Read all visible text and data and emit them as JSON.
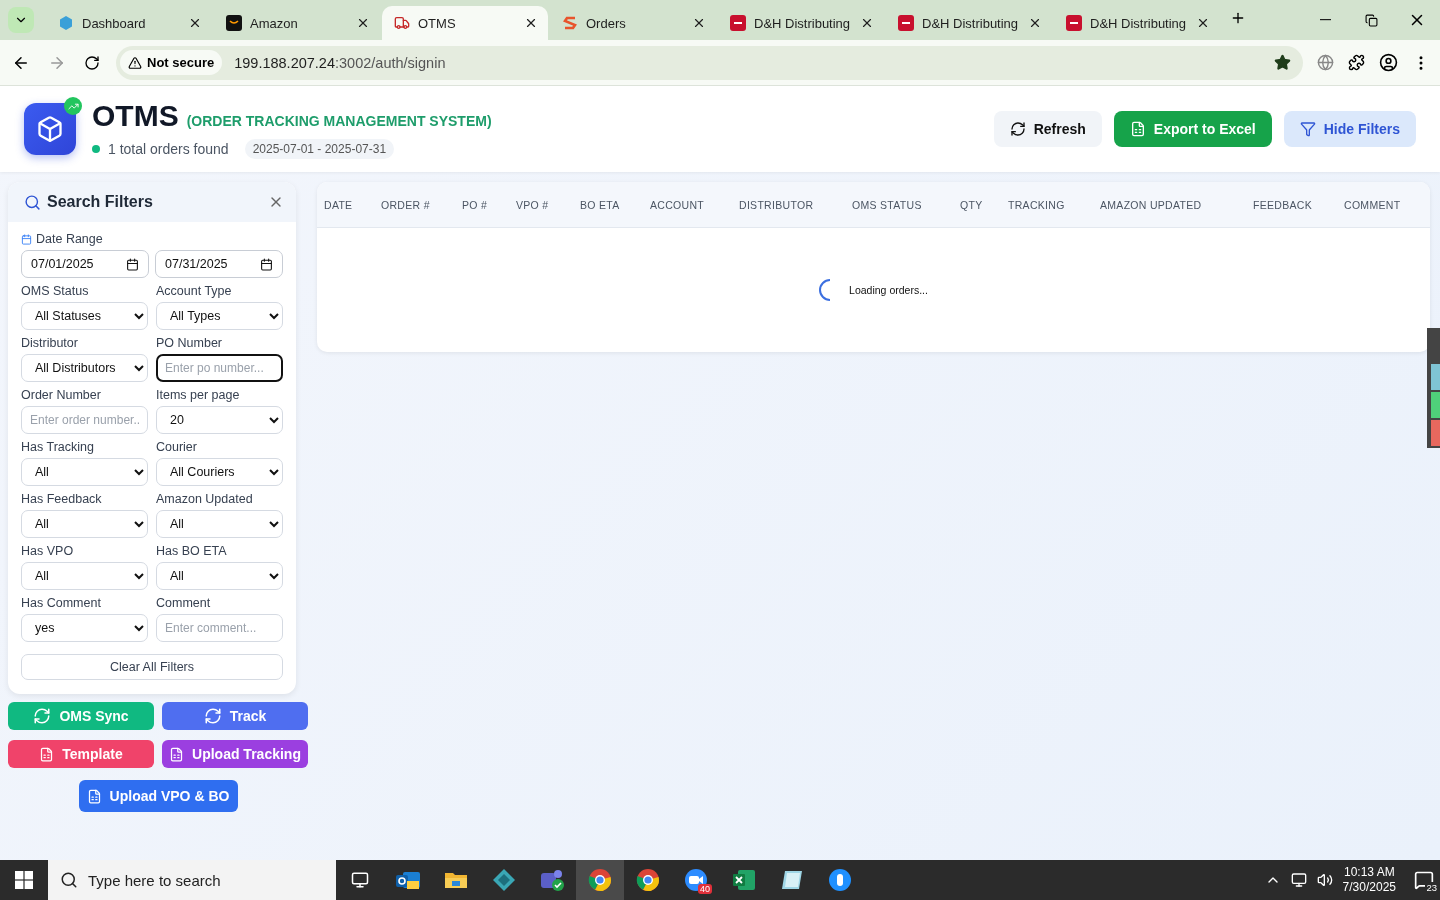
{
  "browser": {
    "tabs": [
      {
        "title": "Dashboard",
        "kind": "dashboard",
        "selected": false
      },
      {
        "title": "Amazon",
        "kind": "amazon",
        "selected": false
      },
      {
        "title": "OTMS",
        "kind": "truck",
        "selected": true
      },
      {
        "title": "Orders",
        "kind": "orders",
        "selected": false
      },
      {
        "title": "D&H Distributing",
        "kind": "dh",
        "selected": false
      },
      {
        "title": "D&H Distributing",
        "kind": "dh",
        "selected": false
      },
      {
        "title": "D&H Distributing",
        "kind": "dh",
        "selected": false
      }
    ],
    "security": "Not secure",
    "url_host": "199.188.207.24",
    "url_path": ":3002/auth/signin",
    "bookmarked": true
  },
  "header": {
    "title": "OTMS",
    "subtitle": "(ORDER TRACKING MANAGEMENT SYSTEM)",
    "count": "1 total orders found",
    "date_range": "2025-07-01 - 2025-07-31",
    "buttons": [
      {
        "label": "Refresh",
        "kind": "refresh"
      },
      {
        "label": "Export to Excel",
        "kind": "export"
      },
      {
        "label": "Hide Filters",
        "kind": "filter"
      }
    ]
  },
  "filters": {
    "title": "Search Filters",
    "date_range": {
      "label": "Date Range",
      "from": "07/01/2025",
      "to": "07/31/2025"
    },
    "fields": [
      {
        "label": "OMS Status",
        "kind": "select",
        "value": "All Statuses"
      },
      {
        "label": "Account Type",
        "kind": "select",
        "value": "All Types"
      },
      {
        "label": "Distributor",
        "kind": "select",
        "value": "All Distributors"
      },
      {
        "label": "PO Number",
        "kind": "input",
        "placeholder": "Enter po number...",
        "focused": true
      },
      {
        "label": "Order Number",
        "kind": "input",
        "placeholder": "Enter order number..",
        "focused": false
      },
      {
        "label": "Items per page",
        "kind": "select",
        "value": "20"
      },
      {
        "label": "Has Tracking",
        "kind": "select",
        "value": "All"
      },
      {
        "label": "Courier",
        "kind": "select",
        "value": "All Couriers"
      },
      {
        "label": "Has Feedback",
        "kind": "select",
        "value": "All"
      },
      {
        "label": "Amazon Updated",
        "kind": "select",
        "value": "All"
      },
      {
        "label": "Has VPO",
        "kind": "select",
        "value": "All"
      },
      {
        "label": "Has BO ETA",
        "kind": "select",
        "value": "All"
      },
      {
        "label": "Has Comment",
        "kind": "select",
        "value": "yes"
      },
      {
        "label": "Comment",
        "kind": "input",
        "placeholder": "Enter comment...",
        "focused": false
      }
    ],
    "clear": "Clear All Filters"
  },
  "actions": [
    {
      "label": "OMS Sync",
      "kind": "sync",
      "color": "#10b981"
    },
    {
      "label": "Track",
      "kind": "sync",
      "color": "#4f6ef0"
    },
    {
      "label": "Template",
      "kind": "file",
      "color": "#f0436a"
    },
    {
      "label": "Upload Tracking",
      "kind": "file",
      "color": "#9b3fe0"
    },
    {
      "label": "Upload VPO & BO",
      "kind": "file",
      "color": "#2f6ef0"
    }
  ],
  "table": {
    "columns": [
      "DATE",
      "ORDER #",
      "PO #",
      "VPO #",
      "BO ETA",
      "ACCOUNT",
      "DISTRIBUTOR",
      "OMS STATUS",
      "QTY",
      "TRACKING",
      "AMAZON UPDATED",
      "FEEDBACK",
      "COMMENT"
    ],
    "loading": "Loading orders..."
  },
  "taskbar": {
    "search_placeholder": "Type here to search",
    "apps": [
      {
        "kind": "mail",
        "active": false
      },
      {
        "kind": "folder",
        "active": false
      },
      {
        "kind": "diamond",
        "active": false
      },
      {
        "kind": "people",
        "active": false
      },
      {
        "kind": "browser",
        "active": true
      },
      {
        "kind": "browser",
        "active": false
      },
      {
        "kind": "video",
        "active": false,
        "badge": "40"
      },
      {
        "kind": "spreadsheet",
        "active": false
      },
      {
        "kind": "notebook",
        "active": false
      },
      {
        "kind": "mouse",
        "active": false
      }
    ],
    "time": "10:13 AM",
    "date": "7/30/2025",
    "notifications": "23"
  }
}
